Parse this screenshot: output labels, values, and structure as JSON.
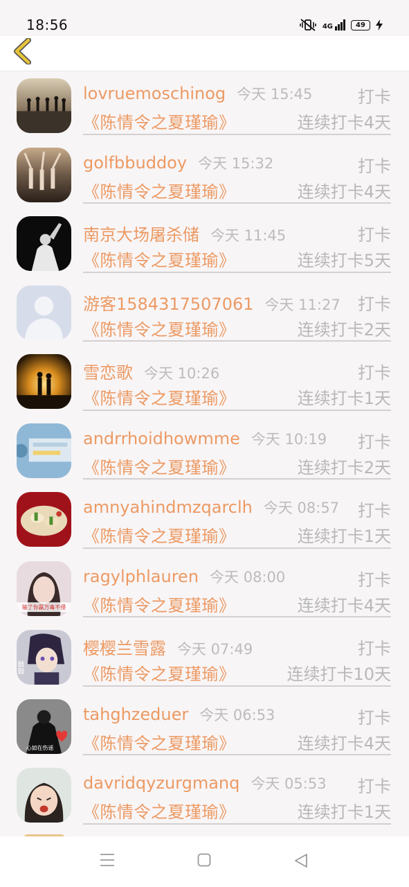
{
  "status_bar": {
    "time": "18:56",
    "network": "4G",
    "battery": "49"
  },
  "list": {
    "items": [
      {
        "name": "lovruemoschinog",
        "time": "今天 15:45",
        "action": "打卡",
        "book": "《陈情令之夏瑾瑜》",
        "streak": "连续打卡4天"
      },
      {
        "name": "golfbbuddoy",
        "time": "今天 15:32",
        "action": "打卡",
        "book": "《陈情令之夏瑾瑜》",
        "streak": "连续打卡4天"
      },
      {
        "name": "南京大场屠杀储",
        "time": "今天 11:45",
        "action": "打卡",
        "book": "《陈情令之夏瑾瑜》",
        "streak": "连续打卡5天"
      },
      {
        "name": "游客1584317507061",
        "time": "今天 11:27",
        "action": "打卡",
        "book": "《陈情令之夏瑾瑜》",
        "streak": "连续打卡2天"
      },
      {
        "name": "雪恋歌",
        "time": "今天 10:26",
        "action": "打卡",
        "book": "《陈情令之夏瑾瑜》",
        "streak": "连续打卡1天"
      },
      {
        "name": "andrrhoidhowmme",
        "time": "今天 10:19",
        "action": "打卡",
        "book": "《陈情令之夏瑾瑜》",
        "streak": "连续打卡2天"
      },
      {
        "name": "amnyahindmzqarclh",
        "time": "今天 08:57",
        "action": "打卡",
        "book": "《陈情令之夏瑾瑜》",
        "streak": "连续打卡1天"
      },
      {
        "name": "ragylphlauren",
        "time": "今天 08:00",
        "action": "打卡",
        "book": "《陈情令之夏瑾瑜》",
        "streak": "连续打卡4天"
      },
      {
        "name": "樱樱兰雪露",
        "time": "今天 07:49",
        "action": "打卡",
        "book": "《陈情令之夏瑾瑜》",
        "streak": "连续打卡10天"
      },
      {
        "name": "tahghzeduer",
        "time": "今天 06:53",
        "action": "打卡",
        "book": "《陈情令之夏瑾瑜》",
        "streak": "连续打卡4天"
      },
      {
        "name": "davridqyzurgmanq",
        "time": "今天 05:53",
        "action": "打卡",
        "book": "《陈情令之夏瑾瑜》",
        "streak": "连续打卡1天"
      }
    ]
  },
  "avatar_overlays": {
    "ragylphlauren": "输了你赢万毒不侵",
    "tahghzeduer": "心如在伤谣",
    "yingying": "鼓鼓"
  },
  "colors": {
    "accent": "#ec9a63",
    "muted": "#b8b8b8",
    "back_arrow": "#e8c43a",
    "background": "#f8f5f7"
  }
}
